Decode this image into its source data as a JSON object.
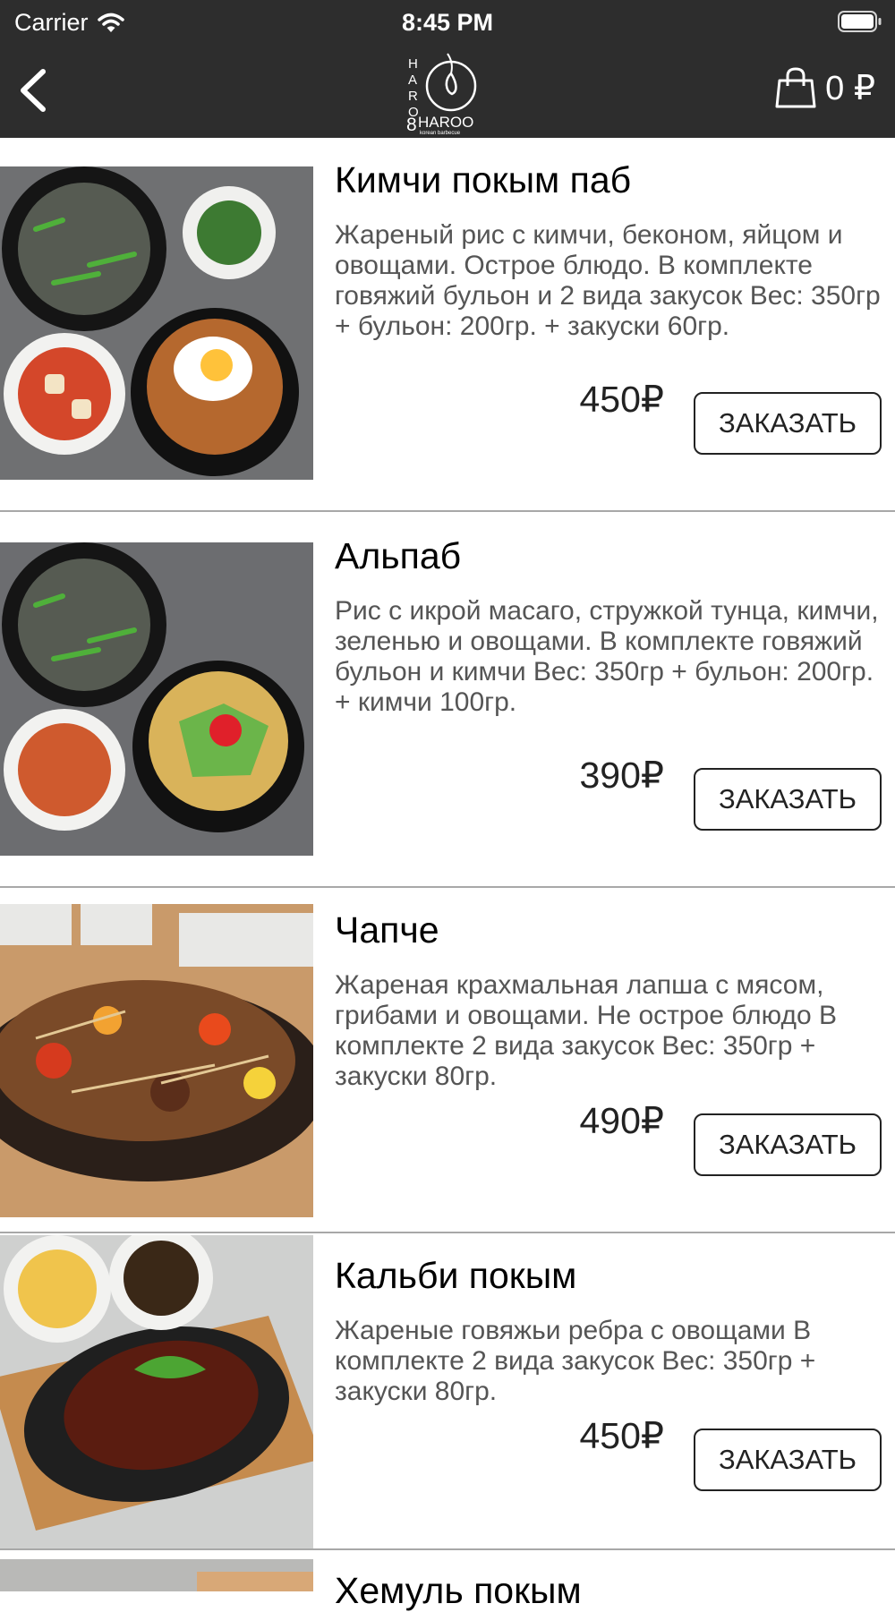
{
  "status_bar": {
    "carrier": "Carrier",
    "time": "8:45 PM"
  },
  "nav": {
    "logo_text": "HAR8HAROO",
    "logo_subtitle": "korean barbecue",
    "cart_total": "0 ₽"
  },
  "colors": {
    "bar": "#2d2d2d",
    "divider": "#a8a8a8",
    "description": "#555555"
  },
  "icons": [
    "wifi-icon",
    "battery-icon",
    "back-chevron-icon",
    "shopping-bag-icon"
  ],
  "menu": {
    "items": [
      {
        "name": "Кимчи покым паб",
        "description": "Жареный рис с кимчи, беконом, яйцом и овощами. Острое блюдо. В комплекте говяжий бульон и 2 вида закусок Вес: 350гр + бульон: 200гр. + закуски 60гр.",
        "price": "450₽",
        "order_label": "ЗАКАЗАТЬ"
      },
      {
        "name": "Альпаб",
        "description": "Рис с икрой масаго, стружкой тунца, кимчи, зеленью и овощами. В комплекте говяжий бульон и кимчи Вес: 350гр + бульон: 200гр. + кимчи 100гр.",
        "price": "390₽",
        "order_label": "ЗАКАЗАТЬ"
      },
      {
        "name": "Чапче",
        "description": "Жареная крахмальная лапша с мясом, грибами и овощами. Не острое блюдо В комплекте 2 вида закусок Вес: 350гр + закуски 80гр.",
        "price": "490₽",
        "order_label": "ЗАКАЗАТЬ"
      },
      {
        "name": "Кальби покым",
        "description": "Жареные говяжьи ребра с овощами В комплекте 2 вида закусок Вес: 350гр + закуски 80гр.",
        "price": "450₽",
        "order_label": "ЗАКАЗАТЬ"
      },
      {
        "name": "Хемуль покым",
        "description": "",
        "price": "",
        "order_label": ""
      }
    ]
  }
}
